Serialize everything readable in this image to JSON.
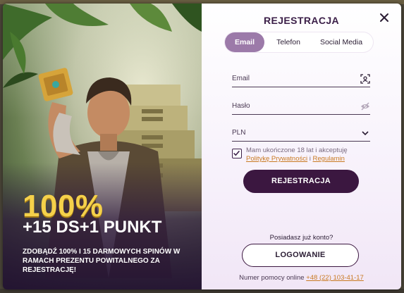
{
  "promo": {
    "percent": "100%",
    "bonus": "+15 DS+1 PUNKT",
    "description": "ZDOBĄDŹ 100% I 15 DARMOWYCH SPINÓW W RAMACH PREZENTU POWITALNEGO ZA REJESTRACJĘ!"
  },
  "form": {
    "title": "REJESTRACJA",
    "tabs": [
      {
        "label": "Email",
        "active": true
      },
      {
        "label": "Telefon",
        "active": false
      },
      {
        "label": "Social Media",
        "active": false
      }
    ],
    "email_label": "Email",
    "password_label": "Hasło",
    "currency_value": "PLN",
    "consent_text": "Mam ukończone 18 lat i akceptuję",
    "privacy_link": "Politykę Prywatności",
    "consent_and": "i",
    "terms_link": "Regulamin",
    "register_button": "REJESTRACJA",
    "have_account": "Posiadasz już konto?",
    "login_button": "LOGOWANIE",
    "helpline_label": "Numer pomocy online",
    "helpline_phone": "+48 (22) 103-41-17"
  },
  "colors": {
    "accent": "#3b1740",
    "tab_active": "#9c7aa9",
    "link": "#c97a22",
    "promo_gold": "#f5d14a"
  },
  "icons": [
    "close-icon",
    "id-scan-icon",
    "eye-off-icon",
    "chevron-down-icon",
    "checkmark-icon"
  ]
}
